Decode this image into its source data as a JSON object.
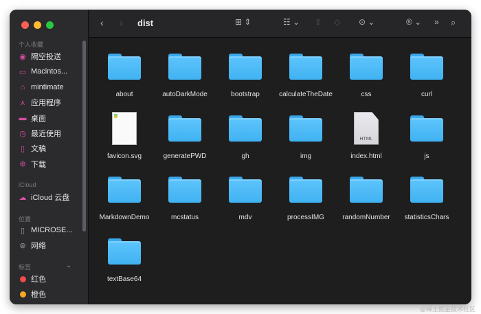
{
  "window": {
    "title": "dist"
  },
  "sidebar": {
    "favorites_header": "个人收藏",
    "favorites": [
      {
        "label": "隔空投送",
        "icon": "airdrop-icon"
      },
      {
        "label": "Macintos...",
        "icon": "harddisk-icon"
      },
      {
        "label": "mintimate",
        "icon": "home-icon"
      },
      {
        "label": "应用程序",
        "icon": "applications-icon"
      },
      {
        "label": "桌面",
        "icon": "desktop-icon"
      },
      {
        "label": "最近使用",
        "icon": "clock-icon"
      },
      {
        "label": "文稿",
        "icon": "document-icon"
      },
      {
        "label": "下载",
        "icon": "download-icon"
      }
    ],
    "icloud_header": "iCloud",
    "icloud": [
      {
        "label": "iCloud 云盘",
        "icon": "cloud-icon"
      }
    ],
    "locations_header": "位置",
    "locations": [
      {
        "label": "MICROSE...",
        "icon": "file-icon"
      },
      {
        "label": "网络",
        "icon": "globe-icon"
      }
    ],
    "tags_header": "标签",
    "tags": [
      {
        "label": "红色",
        "color": "#ee4b4b"
      },
      {
        "label": "橙色",
        "color": "#f5a623"
      }
    ]
  },
  "files": [
    {
      "name": "about",
      "type": "folder"
    },
    {
      "name": "autoDarkMode",
      "type": "folder"
    },
    {
      "name": "bootstrap",
      "type": "folder"
    },
    {
      "name": "calculateTheDate",
      "type": "folder"
    },
    {
      "name": "css",
      "type": "folder"
    },
    {
      "name": "curl",
      "type": "folder"
    },
    {
      "name": "favicon.svg",
      "type": "svg"
    },
    {
      "name": "generatePWD",
      "type": "folder"
    },
    {
      "name": "gh",
      "type": "folder"
    },
    {
      "name": "img",
      "type": "folder"
    },
    {
      "name": "index.html",
      "type": "html",
      "badge": "HTML"
    },
    {
      "name": "js",
      "type": "folder"
    },
    {
      "name": "MarkdownDemo",
      "type": "folder"
    },
    {
      "name": "mcstatus",
      "type": "folder"
    },
    {
      "name": "mdv",
      "type": "folder"
    },
    {
      "name": "processIMG",
      "type": "folder"
    },
    {
      "name": "randomNumber",
      "type": "folder"
    },
    {
      "name": "statisticsChars",
      "type": "folder"
    },
    {
      "name": "textBase64",
      "type": "folder"
    }
  ],
  "watermark": "@稀土掘金技术社区"
}
